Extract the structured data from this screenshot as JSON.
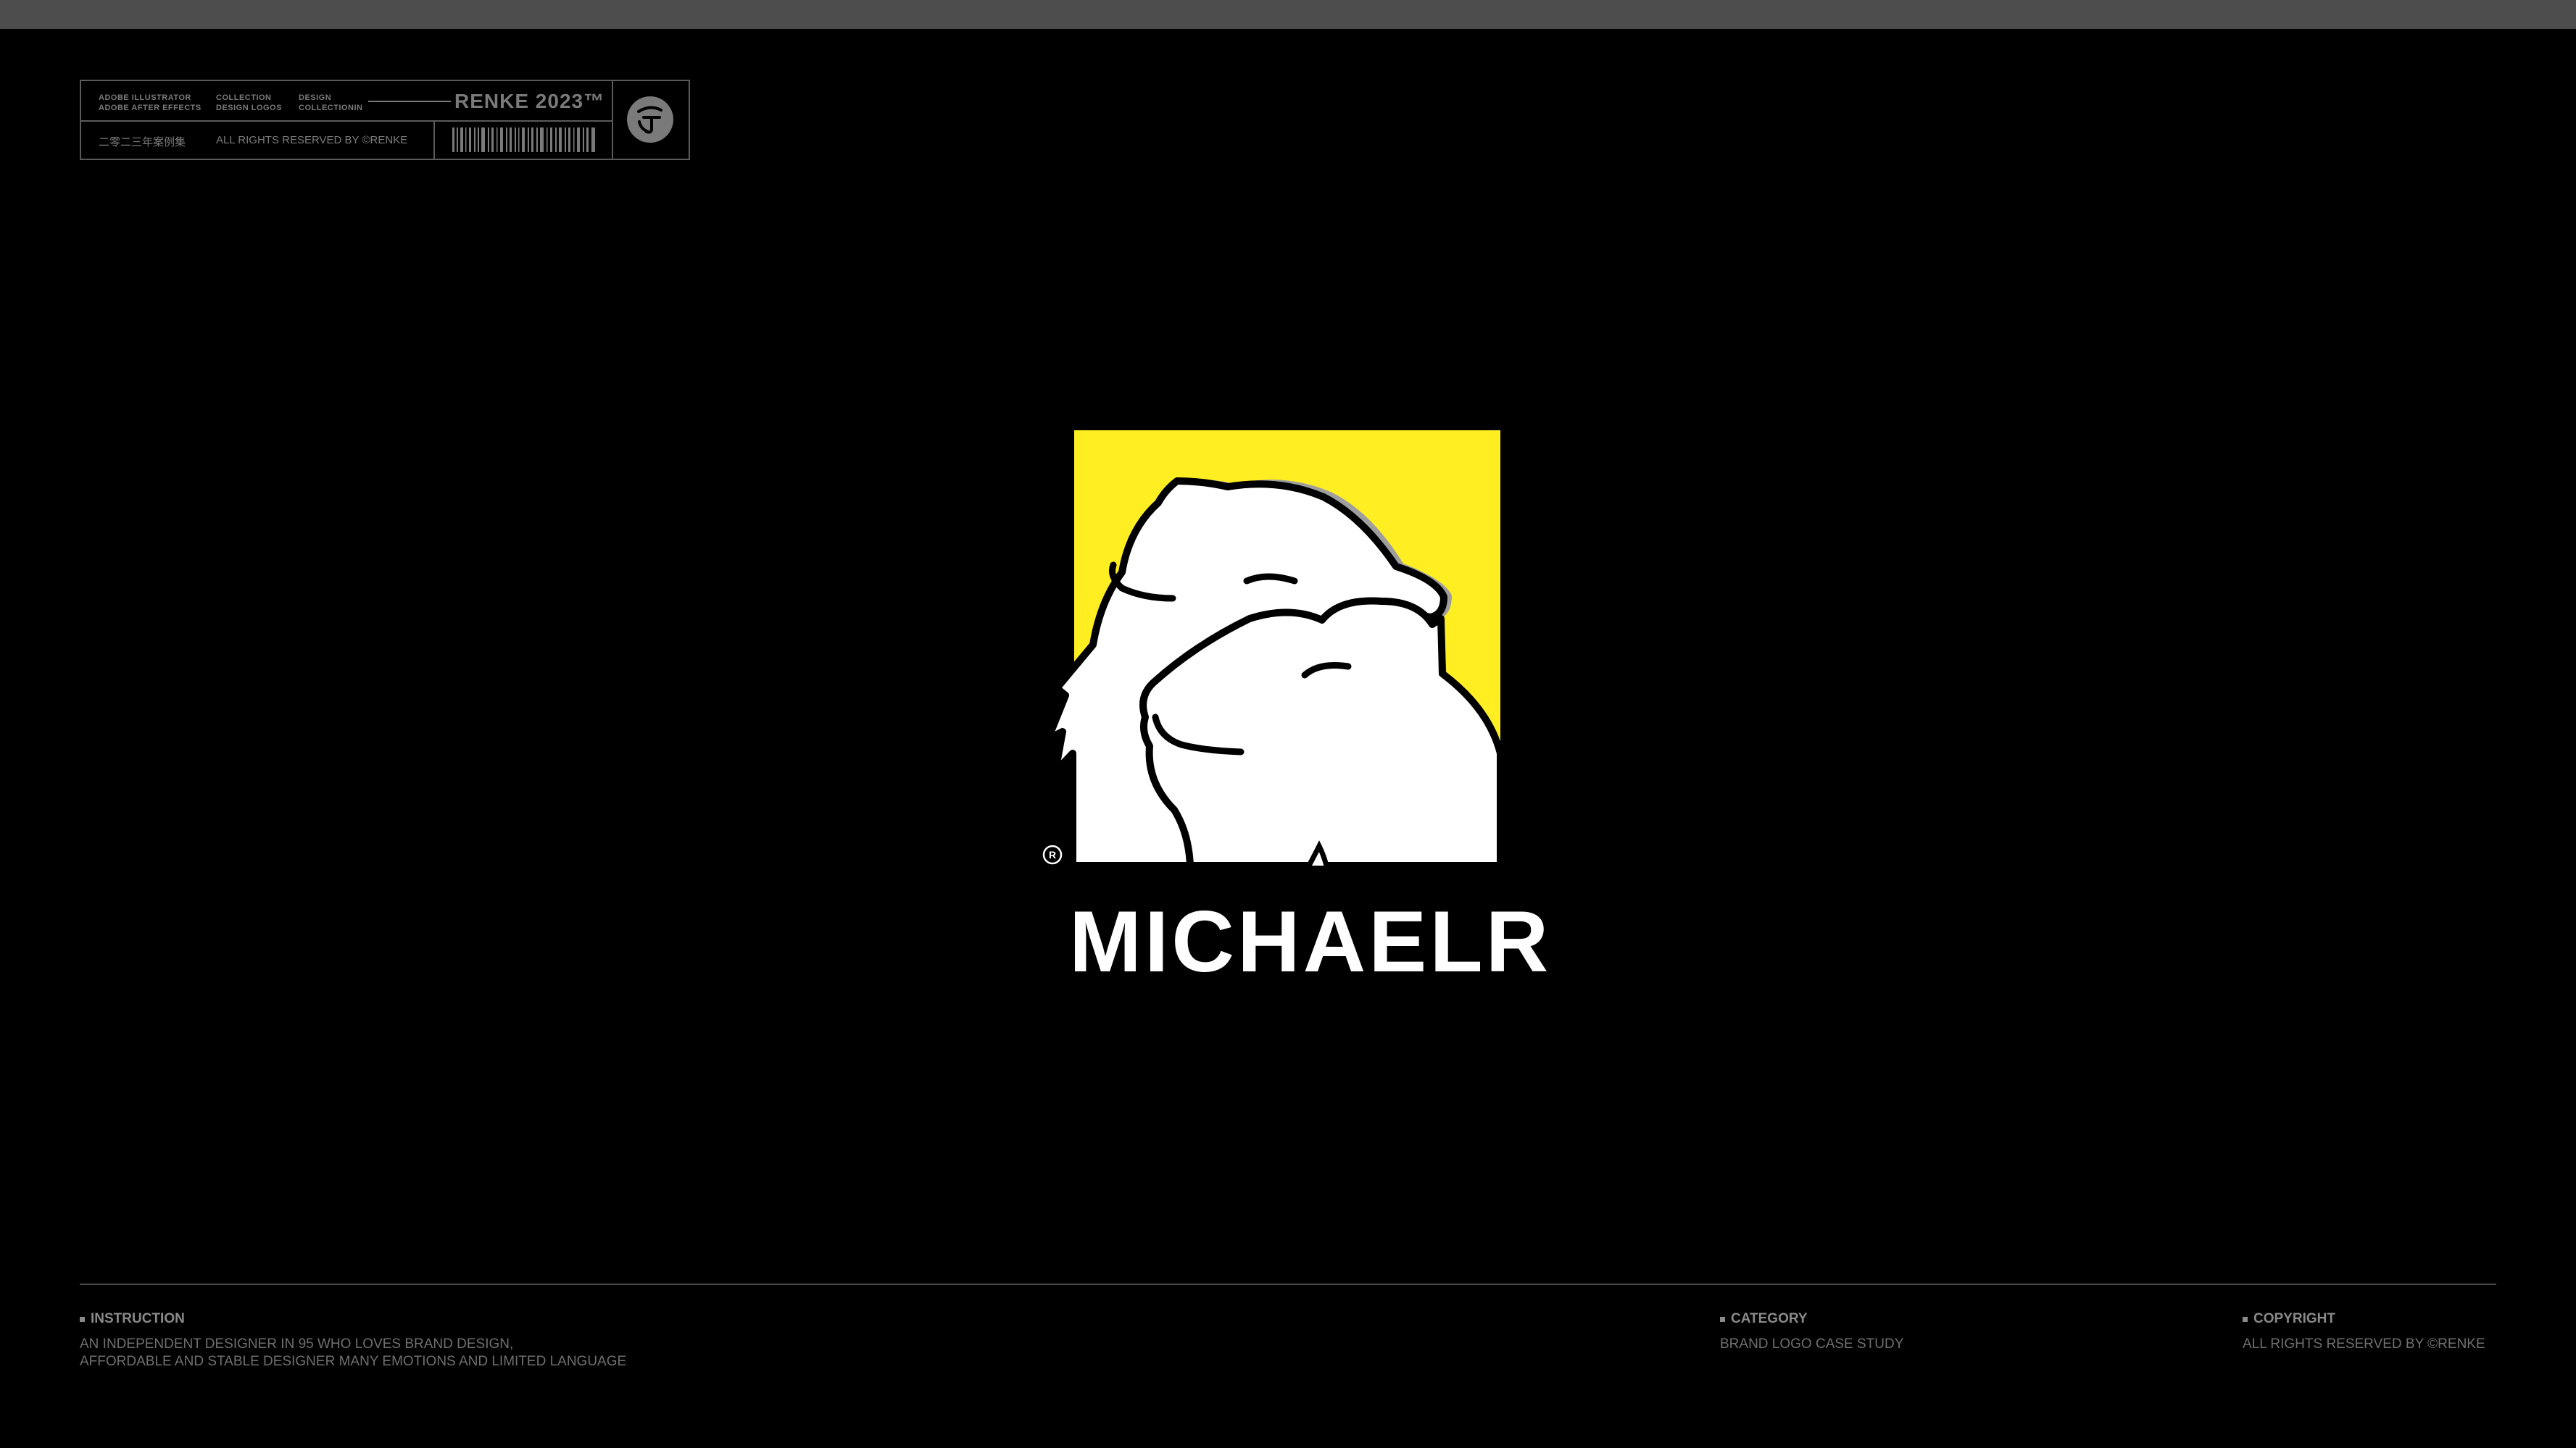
{
  "header": {
    "col1_line1": "ADOBE ILLUSTRATOR",
    "col1_line2": "ADOBE AFTER EFFECTS",
    "col2_line1": "COLLECTION",
    "col2_line2": "DESIGN LOGOS",
    "col3_line1": "DESIGN",
    "col3_line2": "COLLECTIONIN",
    "brand": "RENKE 2023™",
    "chinese_label": "二零二三年案例集",
    "rights": "ALL RIGHTS RESERVED BY ©RENKE"
  },
  "logo": {
    "name": "MICHAELR",
    "registered_mark": "R",
    "icon": "wolf-icon",
    "colors": {
      "accent": "#FFEE22",
      "fill": "#FFFFFF",
      "shadow": "#9E9E9E",
      "outline": "#000000"
    }
  },
  "footer": {
    "instruction": {
      "title": "INSTRUCTION",
      "line1": "AN INDEPENDENT DESIGNER IN 95 WHO LOVES BRAND DESIGN,",
      "line2": "AFFORDABLE AND STABLE DESIGNER MANY EMOTIONS AND LIMITED LANGUAGE"
    },
    "category": {
      "title": "CATEGORY",
      "text": "BRAND LOGO CASE STUDY"
    },
    "copyright": {
      "title": "COPYRIGHT",
      "text": "ALL RIGHTS RESERVED BY ©RENKE"
    }
  }
}
